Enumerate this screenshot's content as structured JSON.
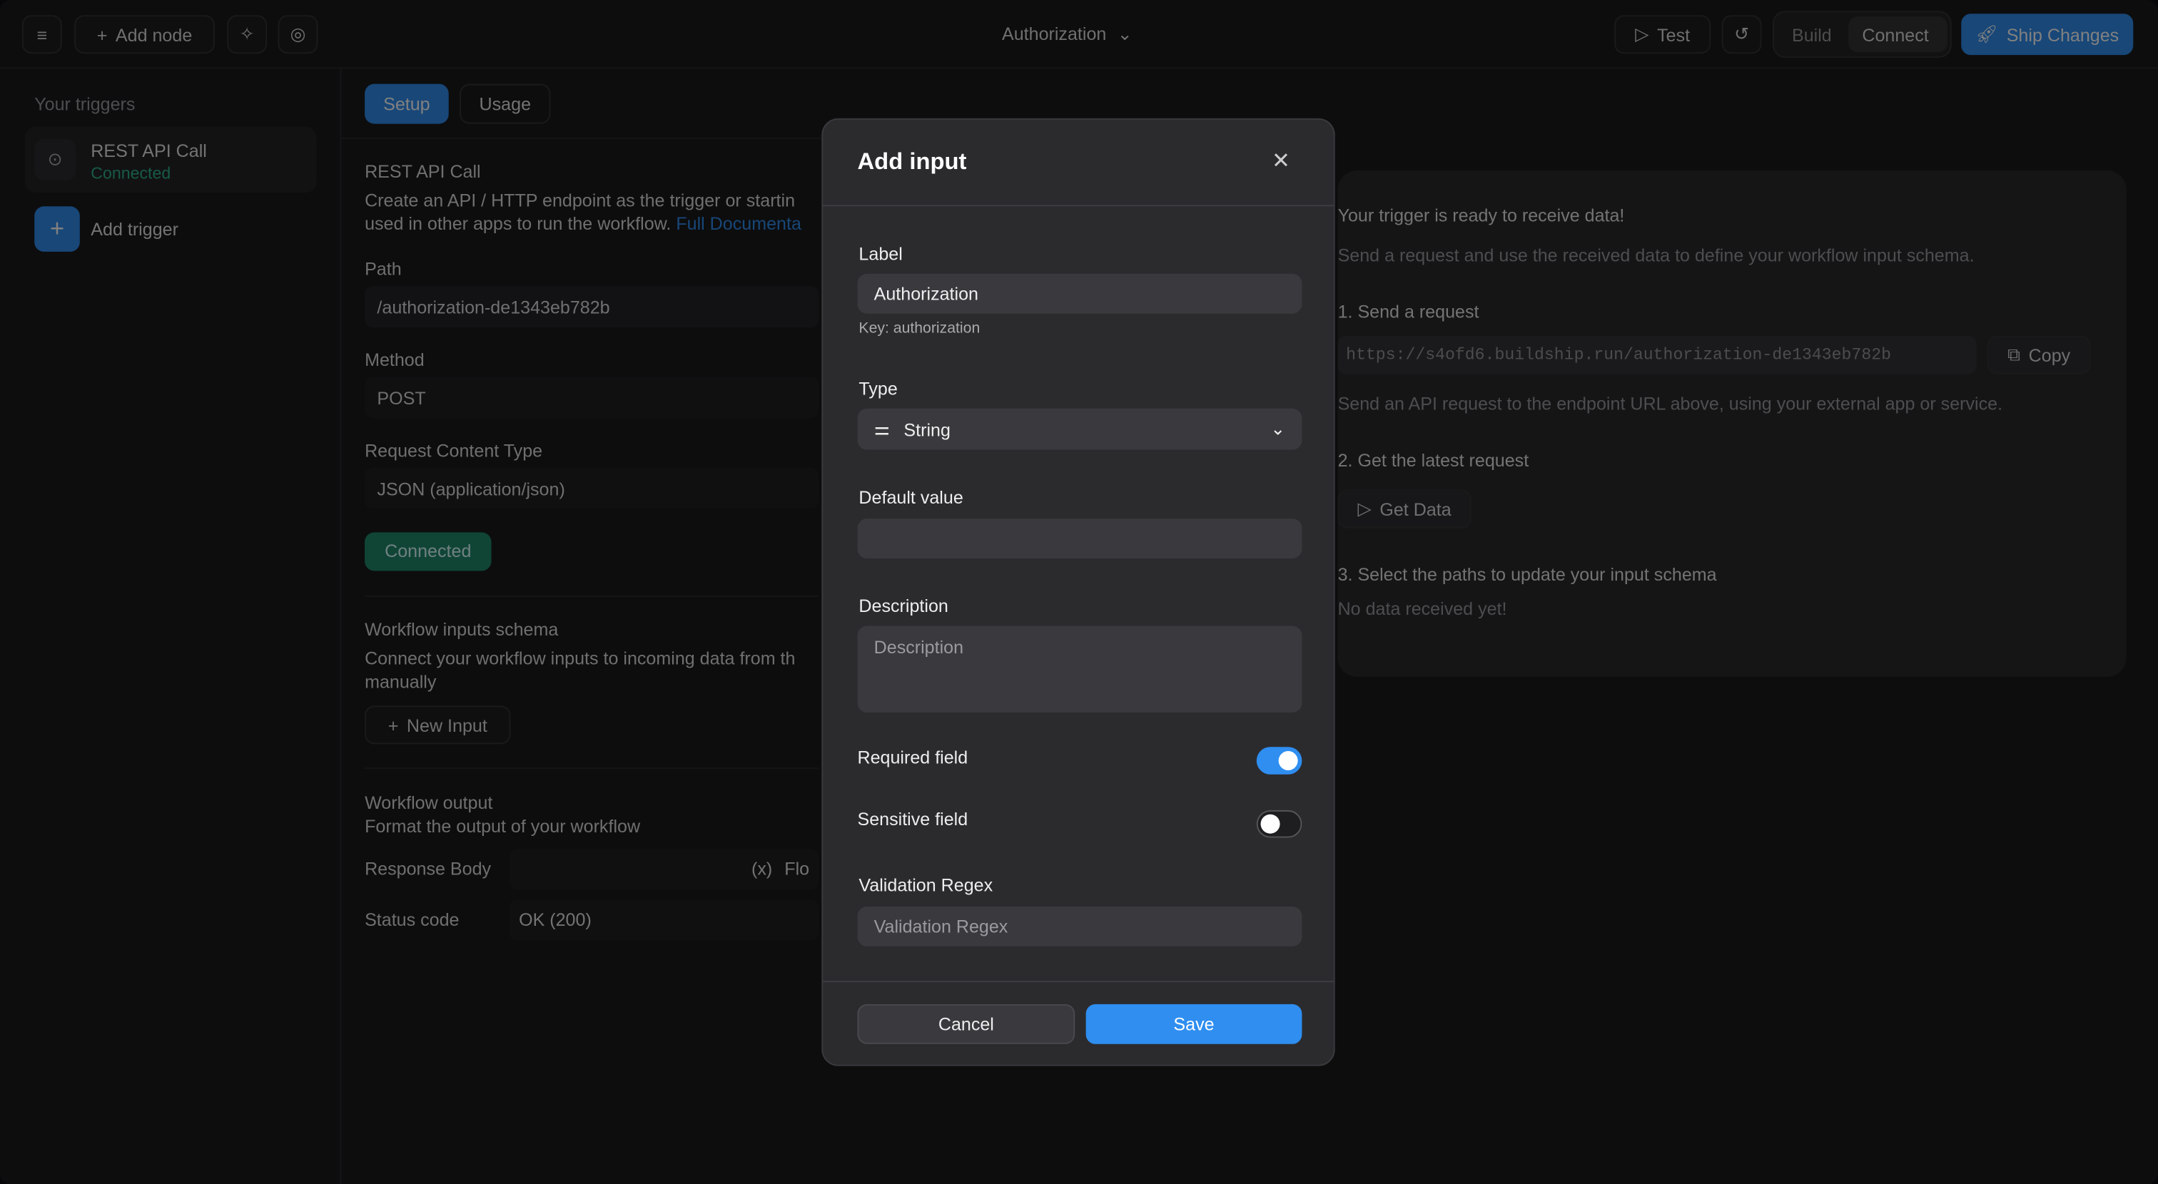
{
  "colors": {
    "accent": "#2f8ef0",
    "success": "#1f8a6a"
  },
  "topbar": {
    "add_node": "Add node",
    "title": "Authorization",
    "test": "Test",
    "build": "Build",
    "connect": "Connect",
    "ship": "Ship Changes"
  },
  "sidebar": {
    "heading": "Your triggers",
    "trigger_name": "REST API Call",
    "trigger_status": "Connected",
    "add_trigger": "Add trigger"
  },
  "tabs": [
    "Setup",
    "Usage"
  ],
  "config": {
    "title": "REST API Call",
    "desc1": "Create an API / HTTP endpoint as the trigger or startin",
    "desc2": "used in other apps to run the workflow.",
    "doc_link": "Full Documenta",
    "path_label": "Path",
    "path_value": "/authorization-de1343eb782b",
    "method_label": "Method",
    "method_value": "POST",
    "ctype_label": "Request Content Type",
    "ctype_value": "JSON (application/json)",
    "connected": "Connected",
    "schema_title": "Workflow inputs schema",
    "schema_desc1": "Connect your workflow inputs to incoming data from th",
    "schema_desc2": "manually",
    "new_input": "New Input",
    "output_title": "Workflow output",
    "output_desc": "Format the output of your workflow",
    "response_body": "Response Body",
    "flow_var": "(x)",
    "flow_text": "Flo",
    "status_code": "Status code",
    "status_value": "OK (200)"
  },
  "panel": {
    "title": "Your trigger is ready to receive data!",
    "subtitle": "Send a request and use the received data to define your workflow input schema.",
    "step1": "1. Send a request",
    "url": "https://s4ofd6.buildship.run/authorization-de1343eb782b",
    "copy": "Copy",
    "step1_note": "Send an API request to the endpoint URL above, using your external app or service.",
    "step2": "2. Get the latest request",
    "get_data": "Get Data",
    "step3": "3. Select the paths to update your input schema",
    "no_data": "No data received yet!"
  },
  "modal": {
    "title": "Add input",
    "label_label": "Label",
    "label_value": "Authorization",
    "key_hint": "Key: authorization",
    "type_label": "Type",
    "type_value": "String",
    "default_label": "Default value",
    "default_value": "",
    "desc_label": "Description",
    "desc_placeholder": "Description",
    "required_label": "Required field",
    "required_on": true,
    "sensitive_label": "Sensitive field",
    "sensitive_on": false,
    "regex_label": "Validation Regex",
    "regex_placeholder": "Validation Regex",
    "cancel": "Cancel",
    "save": "Save"
  }
}
